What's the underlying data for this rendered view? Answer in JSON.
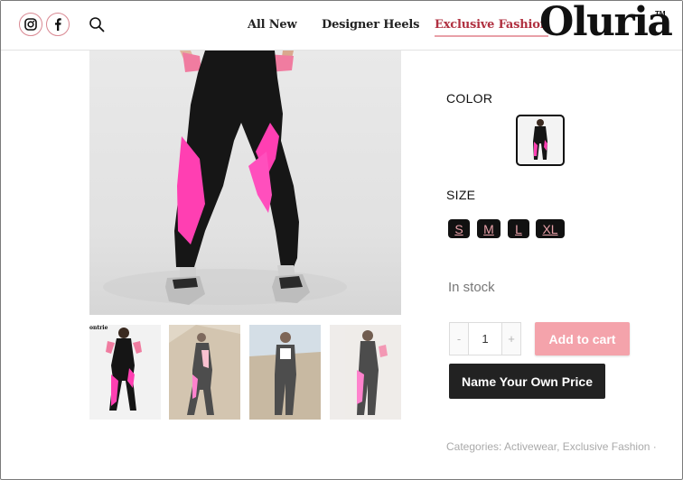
{
  "header": {
    "nav": [
      "All New",
      "Designer Heels",
      "Exclusive Fashion"
    ],
    "active_nav": "Exclusive Fashion",
    "logo": "Oluria",
    "trademark": "TM",
    "icons": [
      "instagram-icon",
      "facebook-icon",
      "search-icon"
    ]
  },
  "product": {
    "thumbnail_caption": "ontrie",
    "color_label": "COLOR",
    "size_label": "SIZE",
    "sizes": [
      "S",
      "M",
      "L",
      "XL"
    ],
    "stock": "In stock",
    "quantity": {
      "minus": "-",
      "value": "1",
      "plus": "+"
    },
    "add_to_cart": "Add to cart",
    "name_price": "Name Your Own Price",
    "categories": "Categories: Activewear, Exclusive Fashion ·"
  },
  "colors": {
    "accent": "#f4a3ab",
    "dark": "#222222",
    "nav_active": "#b03040"
  }
}
